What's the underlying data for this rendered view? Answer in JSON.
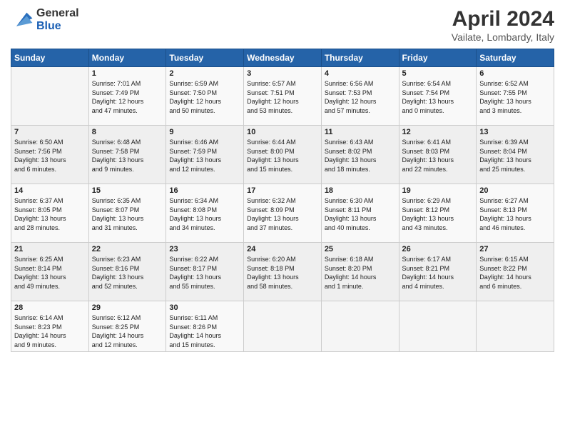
{
  "header": {
    "logo_general": "General",
    "logo_blue": "Blue",
    "title": "April 2024",
    "subtitle": "Vailate, Lombardy, Italy"
  },
  "days_of_week": [
    "Sunday",
    "Monday",
    "Tuesday",
    "Wednesday",
    "Thursday",
    "Friday",
    "Saturday"
  ],
  "weeks": [
    [
      {
        "day": "",
        "info": ""
      },
      {
        "day": "1",
        "info": "Sunrise: 7:01 AM\nSunset: 7:49 PM\nDaylight: 12 hours\nand 47 minutes."
      },
      {
        "day": "2",
        "info": "Sunrise: 6:59 AM\nSunset: 7:50 PM\nDaylight: 12 hours\nand 50 minutes."
      },
      {
        "day": "3",
        "info": "Sunrise: 6:57 AM\nSunset: 7:51 PM\nDaylight: 12 hours\nand 53 minutes."
      },
      {
        "day": "4",
        "info": "Sunrise: 6:56 AM\nSunset: 7:53 PM\nDaylight: 12 hours\nand 57 minutes."
      },
      {
        "day": "5",
        "info": "Sunrise: 6:54 AM\nSunset: 7:54 PM\nDaylight: 13 hours\nand 0 minutes."
      },
      {
        "day": "6",
        "info": "Sunrise: 6:52 AM\nSunset: 7:55 PM\nDaylight: 13 hours\nand 3 minutes."
      }
    ],
    [
      {
        "day": "7",
        "info": "Sunrise: 6:50 AM\nSunset: 7:56 PM\nDaylight: 13 hours\nand 6 minutes."
      },
      {
        "day": "8",
        "info": "Sunrise: 6:48 AM\nSunset: 7:58 PM\nDaylight: 13 hours\nand 9 minutes."
      },
      {
        "day": "9",
        "info": "Sunrise: 6:46 AM\nSunset: 7:59 PM\nDaylight: 13 hours\nand 12 minutes."
      },
      {
        "day": "10",
        "info": "Sunrise: 6:44 AM\nSunset: 8:00 PM\nDaylight: 13 hours\nand 15 minutes."
      },
      {
        "day": "11",
        "info": "Sunrise: 6:43 AM\nSunset: 8:02 PM\nDaylight: 13 hours\nand 18 minutes."
      },
      {
        "day": "12",
        "info": "Sunrise: 6:41 AM\nSunset: 8:03 PM\nDaylight: 13 hours\nand 22 minutes."
      },
      {
        "day": "13",
        "info": "Sunrise: 6:39 AM\nSunset: 8:04 PM\nDaylight: 13 hours\nand 25 minutes."
      }
    ],
    [
      {
        "day": "14",
        "info": "Sunrise: 6:37 AM\nSunset: 8:05 PM\nDaylight: 13 hours\nand 28 minutes."
      },
      {
        "day": "15",
        "info": "Sunrise: 6:35 AM\nSunset: 8:07 PM\nDaylight: 13 hours\nand 31 minutes."
      },
      {
        "day": "16",
        "info": "Sunrise: 6:34 AM\nSunset: 8:08 PM\nDaylight: 13 hours\nand 34 minutes."
      },
      {
        "day": "17",
        "info": "Sunrise: 6:32 AM\nSunset: 8:09 PM\nDaylight: 13 hours\nand 37 minutes."
      },
      {
        "day": "18",
        "info": "Sunrise: 6:30 AM\nSunset: 8:11 PM\nDaylight: 13 hours\nand 40 minutes."
      },
      {
        "day": "19",
        "info": "Sunrise: 6:29 AM\nSunset: 8:12 PM\nDaylight: 13 hours\nand 43 minutes."
      },
      {
        "day": "20",
        "info": "Sunrise: 6:27 AM\nSunset: 8:13 PM\nDaylight: 13 hours\nand 46 minutes."
      }
    ],
    [
      {
        "day": "21",
        "info": "Sunrise: 6:25 AM\nSunset: 8:14 PM\nDaylight: 13 hours\nand 49 minutes."
      },
      {
        "day": "22",
        "info": "Sunrise: 6:23 AM\nSunset: 8:16 PM\nDaylight: 13 hours\nand 52 minutes."
      },
      {
        "day": "23",
        "info": "Sunrise: 6:22 AM\nSunset: 8:17 PM\nDaylight: 13 hours\nand 55 minutes."
      },
      {
        "day": "24",
        "info": "Sunrise: 6:20 AM\nSunset: 8:18 PM\nDaylight: 13 hours\nand 58 minutes."
      },
      {
        "day": "25",
        "info": "Sunrise: 6:18 AM\nSunset: 8:20 PM\nDaylight: 14 hours\nand 1 minute."
      },
      {
        "day": "26",
        "info": "Sunrise: 6:17 AM\nSunset: 8:21 PM\nDaylight: 14 hours\nand 4 minutes."
      },
      {
        "day": "27",
        "info": "Sunrise: 6:15 AM\nSunset: 8:22 PM\nDaylight: 14 hours\nand 6 minutes."
      }
    ],
    [
      {
        "day": "28",
        "info": "Sunrise: 6:14 AM\nSunset: 8:23 PM\nDaylight: 14 hours\nand 9 minutes."
      },
      {
        "day": "29",
        "info": "Sunrise: 6:12 AM\nSunset: 8:25 PM\nDaylight: 14 hours\nand 12 minutes."
      },
      {
        "day": "30",
        "info": "Sunrise: 6:11 AM\nSunset: 8:26 PM\nDaylight: 14 hours\nand 15 minutes."
      },
      {
        "day": "",
        "info": ""
      },
      {
        "day": "",
        "info": ""
      },
      {
        "day": "",
        "info": ""
      },
      {
        "day": "",
        "info": ""
      }
    ]
  ]
}
